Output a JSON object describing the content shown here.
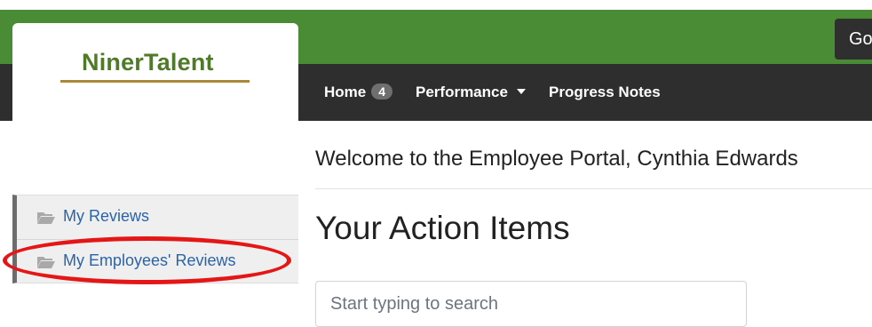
{
  "header": {
    "brand": "NinerTalent",
    "go_button_label": "Go"
  },
  "nav": {
    "home_label": "Home",
    "home_badge": "4",
    "performance_label": "Performance",
    "progress_notes_label": "Progress Notes"
  },
  "main": {
    "welcome_text": "Welcome to the Employee Portal, Cynthia Edwards",
    "section_title": "Your Action Items",
    "search_placeholder": "Start typing to search"
  },
  "sidebar": {
    "items": [
      {
        "label": "My Reviews",
        "icon": "folder-open-icon"
      },
      {
        "label": "My Employees' Reviews",
        "icon": "folder-open-icon"
      }
    ]
  },
  "colors": {
    "header_green": "#4a8c35",
    "nav_dark": "#2e2e2e",
    "brand_text": "#4f7a28",
    "brand_rule": "#a8893a",
    "link_blue": "#2b63a8",
    "annotation_red": "#e51616"
  }
}
